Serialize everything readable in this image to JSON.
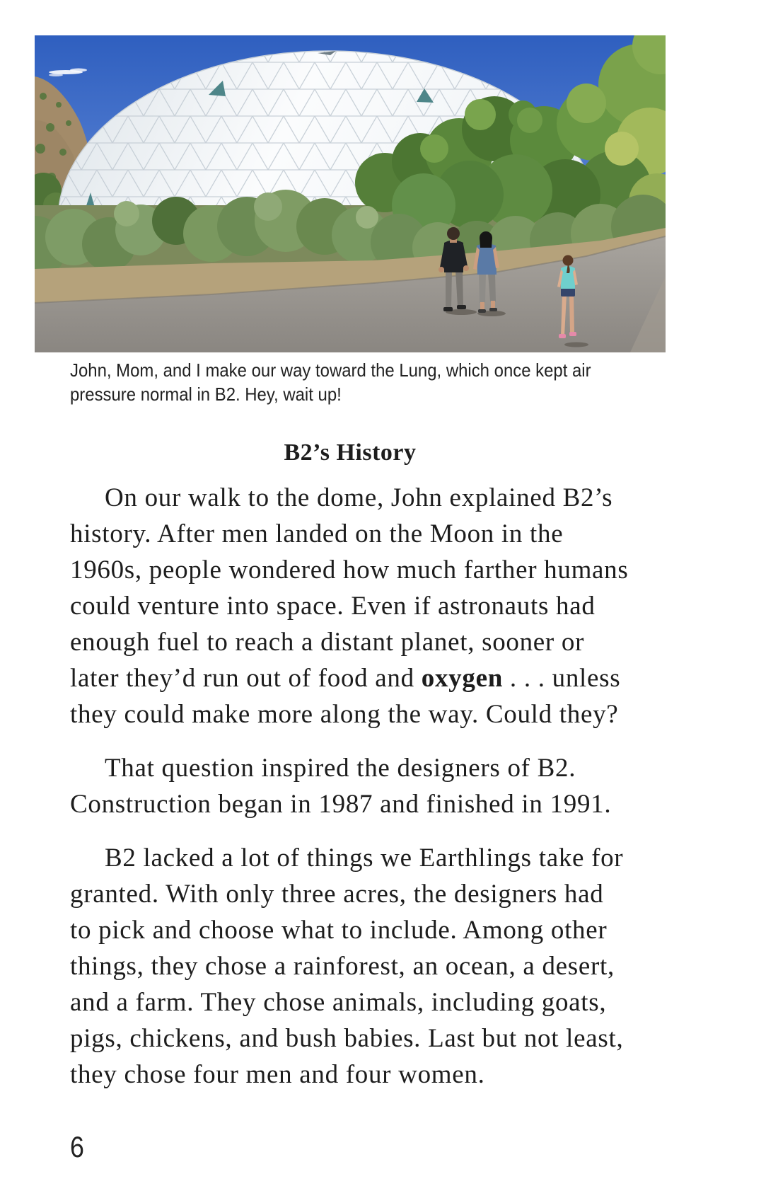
{
  "caption": {
    "lines": [
      "John, Mom, and I make our way toward the Lung, which once kept air",
      "pressure normal in B2. Hey, wait up!"
    ]
  },
  "heading": "B2’s History",
  "paragraphs": [
    {
      "lines": [
        "On our walk to the dome, John explained B2’s",
        "history. After men landed on the Moon in the",
        "1960s, people wondered how much farther humans",
        "could venture into space. Even if astronauts had",
        "enough fuel to reach a distant planet, sooner or",
        {
          "before": "later they’d run out of food and ",
          "bold": "oxygen",
          "after": " . . . unless"
        },
        "they could make more along the way. Could they?"
      ]
    },
    {
      "lines": [
        "That question inspired the designers of B2.",
        "Construction began in 1987 and finished in 1991."
      ]
    },
    {
      "lines": [
        "B2 lacked a lot of things we Earthlings take for",
        "granted. With only three acres, the designers had",
        "to pick and choose what to include. Among other",
        "things, they chose a rainforest, an ocean, a desert,",
        "and a farm. They chose animals, including goats,",
        "pigs, chickens, and bush babies. Last but not least,",
        "they chose four men and four women."
      ]
    }
  ],
  "page_number": "6"
}
